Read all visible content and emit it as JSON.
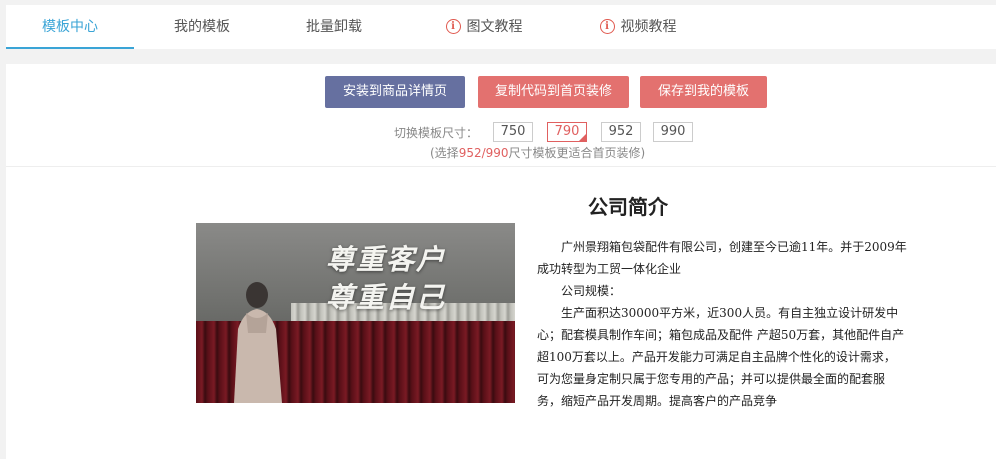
{
  "tabs": [
    {
      "label": "模板中心",
      "active": true
    },
    {
      "label": "我的模板"
    },
    {
      "label": "批量卸载"
    },
    {
      "label": "图文教程",
      "icon": "info-icon"
    },
    {
      "label": "视频教程",
      "icon": "info-icon"
    }
  ],
  "actions": {
    "install": "安装到商品详情页",
    "copy": "复制代码到首页装修",
    "save": "保存到我的模板"
  },
  "size_switch": {
    "label": "切换模板尺寸：",
    "options": [
      "750",
      "790",
      "952",
      "990"
    ],
    "selected": "790",
    "tip_prefix": "(选择",
    "tip_highlight": "952/990",
    "tip_suffix": "尺寸模板更适合首页装修)"
  },
  "preview": {
    "title": "公司简介",
    "image_slogan_line1": "尊重客户",
    "image_slogan_line2": "尊重自己",
    "paragraphs": [
      "广州景翔箱包袋配件有限公司，创建至今已逾11年。并于2009年成功转型为工贸一体化企业",
      "公司规模：",
      "生产面积达30000平方米，近300人员。有自主独立设计研发中心；配套模具制作车间；箱包成品及配件 产超50万套，其他配件自产超100万套以上。产品开发能力可满足自主品牌个性化的设计需求，可为您量身定制只属于您专用的产品；并可以提供最全面的配套服务，缩短产品开发周期。提高客户的产品竞争"
    ]
  },
  "colors": {
    "accent": "#3aa4d6",
    "install_button": "#6670a0",
    "red_button": "#e3716f",
    "highlight": "#e06060"
  }
}
